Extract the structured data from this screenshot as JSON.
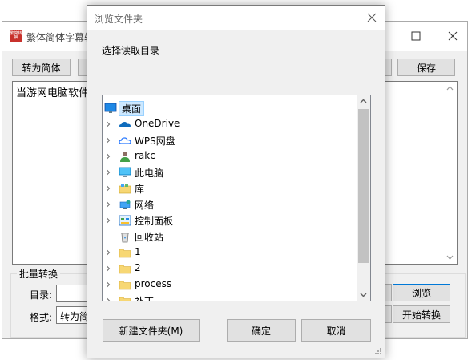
{
  "main_window": {
    "title": "繁体简体字幕转",
    "app_icon_text": "繁简转换",
    "toolbar": {
      "convert_simplified_label": "转为简体",
      "save_label": "保存"
    },
    "content_text": "当游网电脑软件频",
    "batch": {
      "title": "批量转换",
      "directory_label": "目录:",
      "directory_value": "",
      "format_label": "格式:",
      "format_value": "转为简体",
      "browse_label": "浏览",
      "start_label": "开始转换"
    }
  },
  "dialog": {
    "title": "浏览文件夹",
    "instruction": "选择读取目录",
    "tree_items": [
      {
        "label": "桌面",
        "icon": "desktop-icon",
        "selected": true,
        "expandable": false
      },
      {
        "label": "OneDrive",
        "icon": "onedrive-cloud-icon",
        "selected": false,
        "expandable": true
      },
      {
        "label": "WPS网盘",
        "icon": "wps-cloud-icon",
        "selected": false,
        "expandable": true
      },
      {
        "label": "rakc",
        "icon": "user-icon",
        "selected": false,
        "expandable": true
      },
      {
        "label": "此电脑",
        "icon": "computer-icon",
        "selected": false,
        "expandable": true
      },
      {
        "label": "库",
        "icon": "library-icon",
        "selected": false,
        "expandable": true
      },
      {
        "label": "网络",
        "icon": "network-icon",
        "selected": false,
        "expandable": true
      },
      {
        "label": "控制面板",
        "icon": "control-panel-icon",
        "selected": false,
        "expandable": true
      },
      {
        "label": "回收站",
        "icon": "recycle-bin-icon",
        "selected": false,
        "expandable": false
      },
      {
        "label": "1",
        "icon": "folder-icon",
        "selected": false,
        "expandable": true
      },
      {
        "label": "2",
        "icon": "folder-icon",
        "selected": false,
        "expandable": true
      },
      {
        "label": "process",
        "icon": "folder-icon",
        "selected": false,
        "expandable": true
      },
      {
        "label": "补丁",
        "icon": "folder-icon",
        "selected": false,
        "expandable": true
      }
    ],
    "buttons": {
      "new_folder": "新建文件夹(M)",
      "ok": "确定",
      "cancel": "取消"
    }
  },
  "colors": {
    "selection_bg": "#cce8ff",
    "folder": "#f7d774",
    "accent": "#0078d7"
  }
}
